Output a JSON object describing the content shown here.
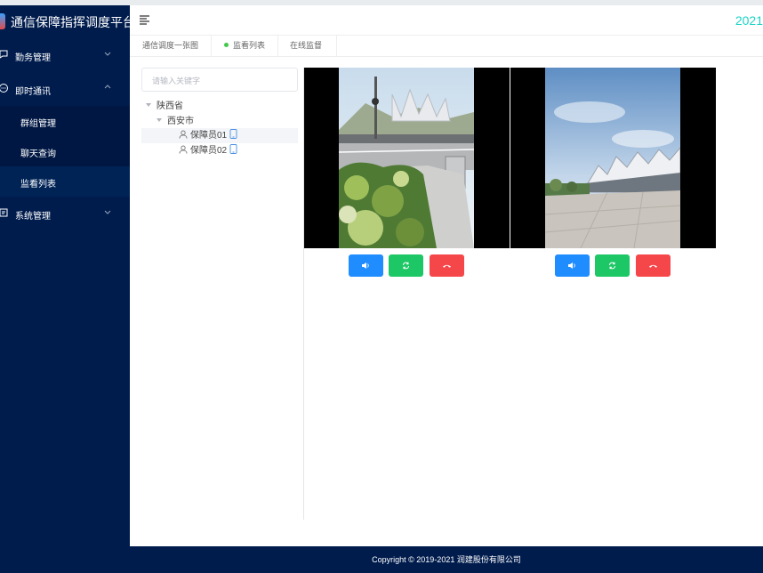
{
  "app": {
    "title": "通信保障指挥调度平台",
    "year": "2021"
  },
  "sidebar": {
    "menus": [
      {
        "label": "勤务管理",
        "icon": "duty-icon",
        "expanded": false
      },
      {
        "label": "即时通讯",
        "icon": "chat-icon",
        "expanded": true,
        "children": [
          {
            "label": "群组管理"
          },
          {
            "label": "聊天查询"
          },
          {
            "label": "监看列表",
            "active": true
          }
        ]
      },
      {
        "label": "系统管理",
        "icon": "settings-icon",
        "expanded": false
      }
    ]
  },
  "tabs": [
    {
      "label": "通信调度一张图",
      "active": false
    },
    {
      "label": "监看列表",
      "active": true
    },
    {
      "label": "在线监督",
      "active": false
    }
  ],
  "search": {
    "placeholder": "请输入关键字"
  },
  "tree": {
    "province": "陕西省",
    "city": "西安市",
    "users": [
      {
        "name": "保障员01",
        "selected": true
      },
      {
        "name": "保障员02",
        "selected": false
      }
    ]
  },
  "controls": [
    "speaker-icon",
    "switch-camera-icon",
    "hangup-icon"
  ],
  "colors": {
    "sidebar": "#001c4d",
    "accent_year": "#19d3c5",
    "blue": "#1f8cff",
    "green": "#1ec766",
    "red": "#f5474a"
  },
  "footer": {
    "copyright": "Copyright © 2019-2021 润建股份有限公司"
  }
}
